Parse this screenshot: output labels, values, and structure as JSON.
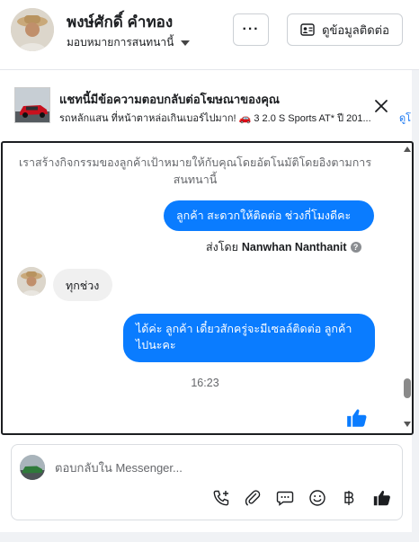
{
  "header": {
    "contact_name": "พงษ์ศักดิ์ คำทอง",
    "assign_label": "มอบหมายการสนทนานี้",
    "more_label": "···",
    "info_button_label": "ดูข้อมูลติดต่อ"
  },
  "ad_banner": {
    "title": "แชทนี้มีข้อความตอบกลับต่อโฆษณาของคุณ",
    "subtitle": "รถหลักแสน ที่หน้าตาหล่อเกินเบอร์ไปมาก! 🚗 3 2.0 S Sports AT* ปี 201...",
    "link_label": "ดูโ"
  },
  "conversation": {
    "system_message": "เราสร้างกิจกรรมของลูกค้าเป้าหมายให้กับคุณโดยอัตโนมัติโดยอิงตามการสนทนานี้",
    "messages": [
      {
        "direction": "outgoing",
        "text": "ลูกค้า  สะดวกให้ติดต่อ ช่วงกี่โมงดีคะ"
      },
      {
        "direction": "incoming",
        "text": "ทุกช่วง"
      },
      {
        "direction": "outgoing",
        "text": "ได้ค่ะ  ลูกค้า   เดี๋ยวสักครู่จะมีเซลล์ติดต่อ ลูกค้า  ไปนะคะ"
      }
    ],
    "sent_by_prefix": "ส่งโดย",
    "sent_by_name": "Nanwhan Nanthanit",
    "timestamp": "16:23"
  },
  "reply": {
    "placeholder": "ตอบกลับใน Messenger..."
  },
  "toolbar_icons": [
    "call-add-icon",
    "attachment-icon",
    "chat-bubble-icon",
    "emoji-icon",
    "baht-icon",
    "like-icon"
  ],
  "colors": {
    "accent": "#0a7cff",
    "link": "#1877f2",
    "incoming_bubble": "#f0f0f0",
    "muted_text": "#65676b"
  }
}
